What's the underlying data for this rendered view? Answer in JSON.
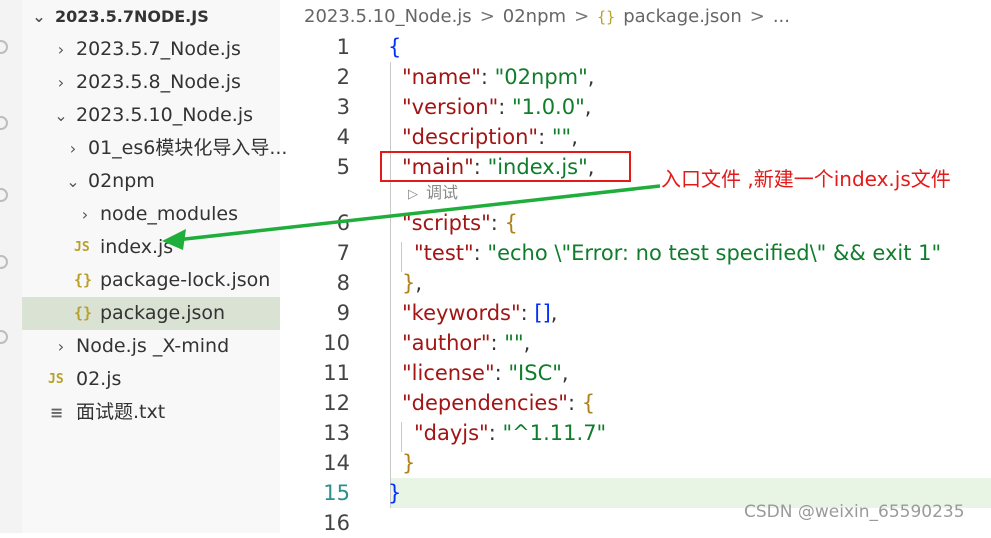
{
  "sidebar": {
    "root": "2023.5.7NODE.JS",
    "items": [
      {
        "label": "2023.5.7_Node.js",
        "chevron": "›",
        "icon": "",
        "icon_type": "folder"
      },
      {
        "label": "2023.5.8_Node.js",
        "chevron": "›",
        "icon": "",
        "icon_type": "folder"
      },
      {
        "label": "2023.5.10_Node.js",
        "chevron": "⌄",
        "icon": "",
        "icon_type": "folder-open"
      },
      {
        "label": "01_es6模块化导入导...",
        "chevron": "›",
        "icon": "",
        "icon_type": "folder"
      },
      {
        "label": "02npm",
        "chevron": "⌄",
        "icon": "",
        "icon_type": "folder-open"
      },
      {
        "label": "node_modules",
        "chevron": "›",
        "icon": "",
        "icon_type": "folder"
      },
      {
        "label": "index.js",
        "chevron": "",
        "icon": "JS",
        "icon_type": "js"
      },
      {
        "label": "package-lock.json",
        "chevron": "",
        "icon": "{}",
        "icon_type": "json"
      },
      {
        "label": "package.json",
        "chevron": "",
        "icon": "{}",
        "icon_type": "json",
        "selected": true
      },
      {
        "label": "Node.js _X-mind",
        "chevron": "›",
        "icon": "",
        "icon_type": "folder"
      },
      {
        "label": "02.js",
        "chevron": "",
        "icon": "JS",
        "icon_type": "js"
      },
      {
        "label": "面试题.txt",
        "chevron": "",
        "icon": "≡",
        "icon_type": "txt"
      }
    ]
  },
  "breadcrumb": {
    "parts": [
      "2023.5.10_Node.js",
      "02npm",
      "package.json",
      "..."
    ],
    "separator": ">",
    "file_icon": "{}"
  },
  "editor": {
    "line_numbers": [
      "1",
      "2",
      "3",
      "4",
      "5",
      "6",
      "7",
      "8",
      "9",
      "10",
      "11",
      "12",
      "13",
      "14",
      "15",
      "16"
    ],
    "active_line": 15,
    "codelens": "调试",
    "lines": {
      "l1": {
        "open": "{"
      },
      "l2": {
        "key": "\"name\"",
        "colon": ": ",
        "val": "\"02npm\"",
        "comma": ","
      },
      "l3": {
        "key": "\"version\"",
        "colon": ": ",
        "val": "\"1.0.0\"",
        "comma": ","
      },
      "l4": {
        "key": "\"description\"",
        "colon": ": ",
        "val": "\"\"",
        "comma": ","
      },
      "l5": {
        "key": "\"main\"",
        "colon": ": ",
        "val": "\"index.js\"",
        "comma": ","
      },
      "l6": {
        "key": "\"scripts\"",
        "colon": ": ",
        "open": "{"
      },
      "l7": {
        "key": "\"test\"",
        "colon": ": ",
        "val": "\"echo \\\"Error: no test specified\\\" && exit 1\""
      },
      "l8": {
        "close": "}",
        "comma": ","
      },
      "l9": {
        "key": "\"keywords\"",
        "colon": ": ",
        "val": "[]",
        "comma": ","
      },
      "l10": {
        "key": "\"author\"",
        "colon": ": ",
        "val": "\"\"",
        "comma": ","
      },
      "l11": {
        "key": "\"license\"",
        "colon": ": ",
        "val": "\"ISC\"",
        "comma": ","
      },
      "l12": {
        "key": "\"dependencies\"",
        "colon": ": ",
        "open": "{"
      },
      "l13": {
        "key": "\"dayjs\"",
        "colon": ": ",
        "val": "\"^1.11.7\""
      },
      "l14": {
        "close": "}"
      },
      "l15": {
        "close": "}"
      }
    }
  },
  "annotation": {
    "text": "入口文件 ,新建一个index.js文件",
    "color": "#e21a1a",
    "arrow_color": "#1fae3b"
  },
  "watermark": "CSDN @weixin_65590235",
  "colors": {
    "json_key": "#a31515",
    "json_string": "#0f7d2b",
    "json_bracket": "#0431fa",
    "selected_bg": "#d9e2d3",
    "current_line_bg": "#e9f5e4"
  }
}
